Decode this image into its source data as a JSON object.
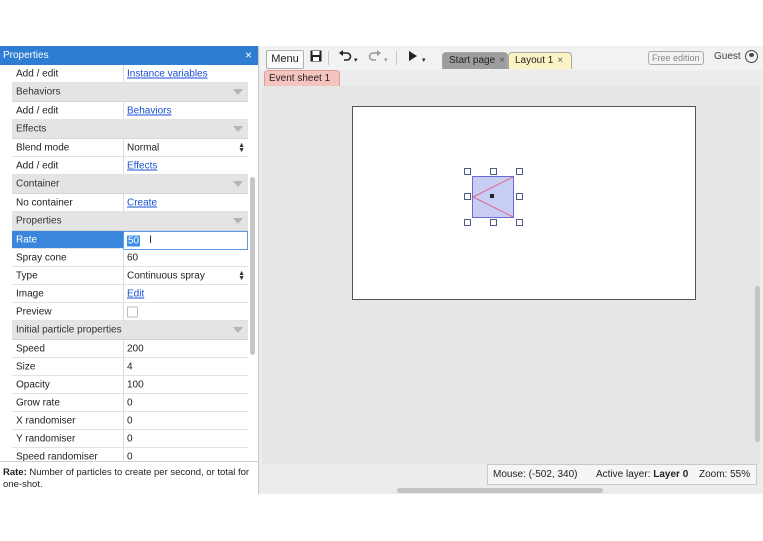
{
  "properties_panel": {
    "title": "Properties",
    "close_label": "×",
    "rows": [
      {
        "kind": "prop",
        "label": "Add / edit",
        "value": "Instance variables",
        "value_type": "link"
      },
      {
        "kind": "cat",
        "label": "Behaviors"
      },
      {
        "kind": "prop",
        "label": "Add / edit",
        "value": "Behaviors",
        "value_type": "link"
      },
      {
        "kind": "cat",
        "label": "Effects"
      },
      {
        "kind": "prop",
        "label": "Blend mode",
        "value": "Normal",
        "value_type": "select"
      },
      {
        "kind": "prop",
        "label": "Add / edit",
        "value": "Effects",
        "value_type": "link"
      },
      {
        "kind": "cat",
        "label": "Container"
      },
      {
        "kind": "prop",
        "label": "No container",
        "value": "Create",
        "value_type": "link"
      },
      {
        "kind": "cat",
        "label": "Properties"
      },
      {
        "kind": "prop",
        "label": "Rate",
        "value": "50",
        "value_type": "input",
        "selected": true
      },
      {
        "kind": "prop",
        "label": "Spray cone",
        "value": "60",
        "value_type": "text"
      },
      {
        "kind": "prop",
        "label": "Type",
        "value": "Continuous spray",
        "value_type": "select"
      },
      {
        "kind": "prop",
        "label": "Image",
        "value": "Edit",
        "value_type": "link"
      },
      {
        "kind": "prop",
        "label": "Preview",
        "value": "",
        "value_type": "checkbox"
      },
      {
        "kind": "cat",
        "label": "Initial particle properties"
      },
      {
        "kind": "prop",
        "label": "Speed",
        "value": "200",
        "value_type": "text"
      },
      {
        "kind": "prop",
        "label": "Size",
        "value": "4",
        "value_type": "text"
      },
      {
        "kind": "prop",
        "label": "Opacity",
        "value": "100",
        "value_type": "text"
      },
      {
        "kind": "prop",
        "label": "Grow rate",
        "value": "0",
        "value_type": "text"
      },
      {
        "kind": "prop",
        "label": "X randomiser",
        "value": "0",
        "value_type": "text"
      },
      {
        "kind": "prop",
        "label": "Y randomiser",
        "value": "0",
        "value_type": "text"
      },
      {
        "kind": "prop",
        "label": "Speed randomiser",
        "value": "0",
        "value_type": "text"
      }
    ],
    "help": {
      "bold": "Rate:",
      "text": " Number of particles to create per second, or total for one-shot."
    }
  },
  "toolbar": {
    "menu_label": "Menu",
    "icons": [
      "save-icon",
      "undo-icon",
      "redo-icon",
      "play-icon"
    ],
    "tabs": [
      {
        "label": "Start page",
        "close": "×"
      },
      {
        "label": "Layout 1",
        "close": "×",
        "active": true
      }
    ],
    "badge": "Free edition",
    "user": "Guest"
  },
  "subtabs": [
    {
      "label": "Event sheet 1",
      "close": "×"
    }
  ],
  "statusbar": {
    "mouse_label": "Mouse:",
    "mouse_value": "(-502, 340)",
    "layer_label": "Active layer:",
    "layer_value": "Layer 0",
    "zoom_label": "Zoom:",
    "zoom_value": "55%"
  },
  "colors": {
    "panel_title_bg": "#2d7dd2",
    "selected_row_bg": "#3a86dc",
    "link": "#1a4fd6",
    "tab_active": "#fbf3c4",
    "tab_event": "#f6c4bf"
  }
}
